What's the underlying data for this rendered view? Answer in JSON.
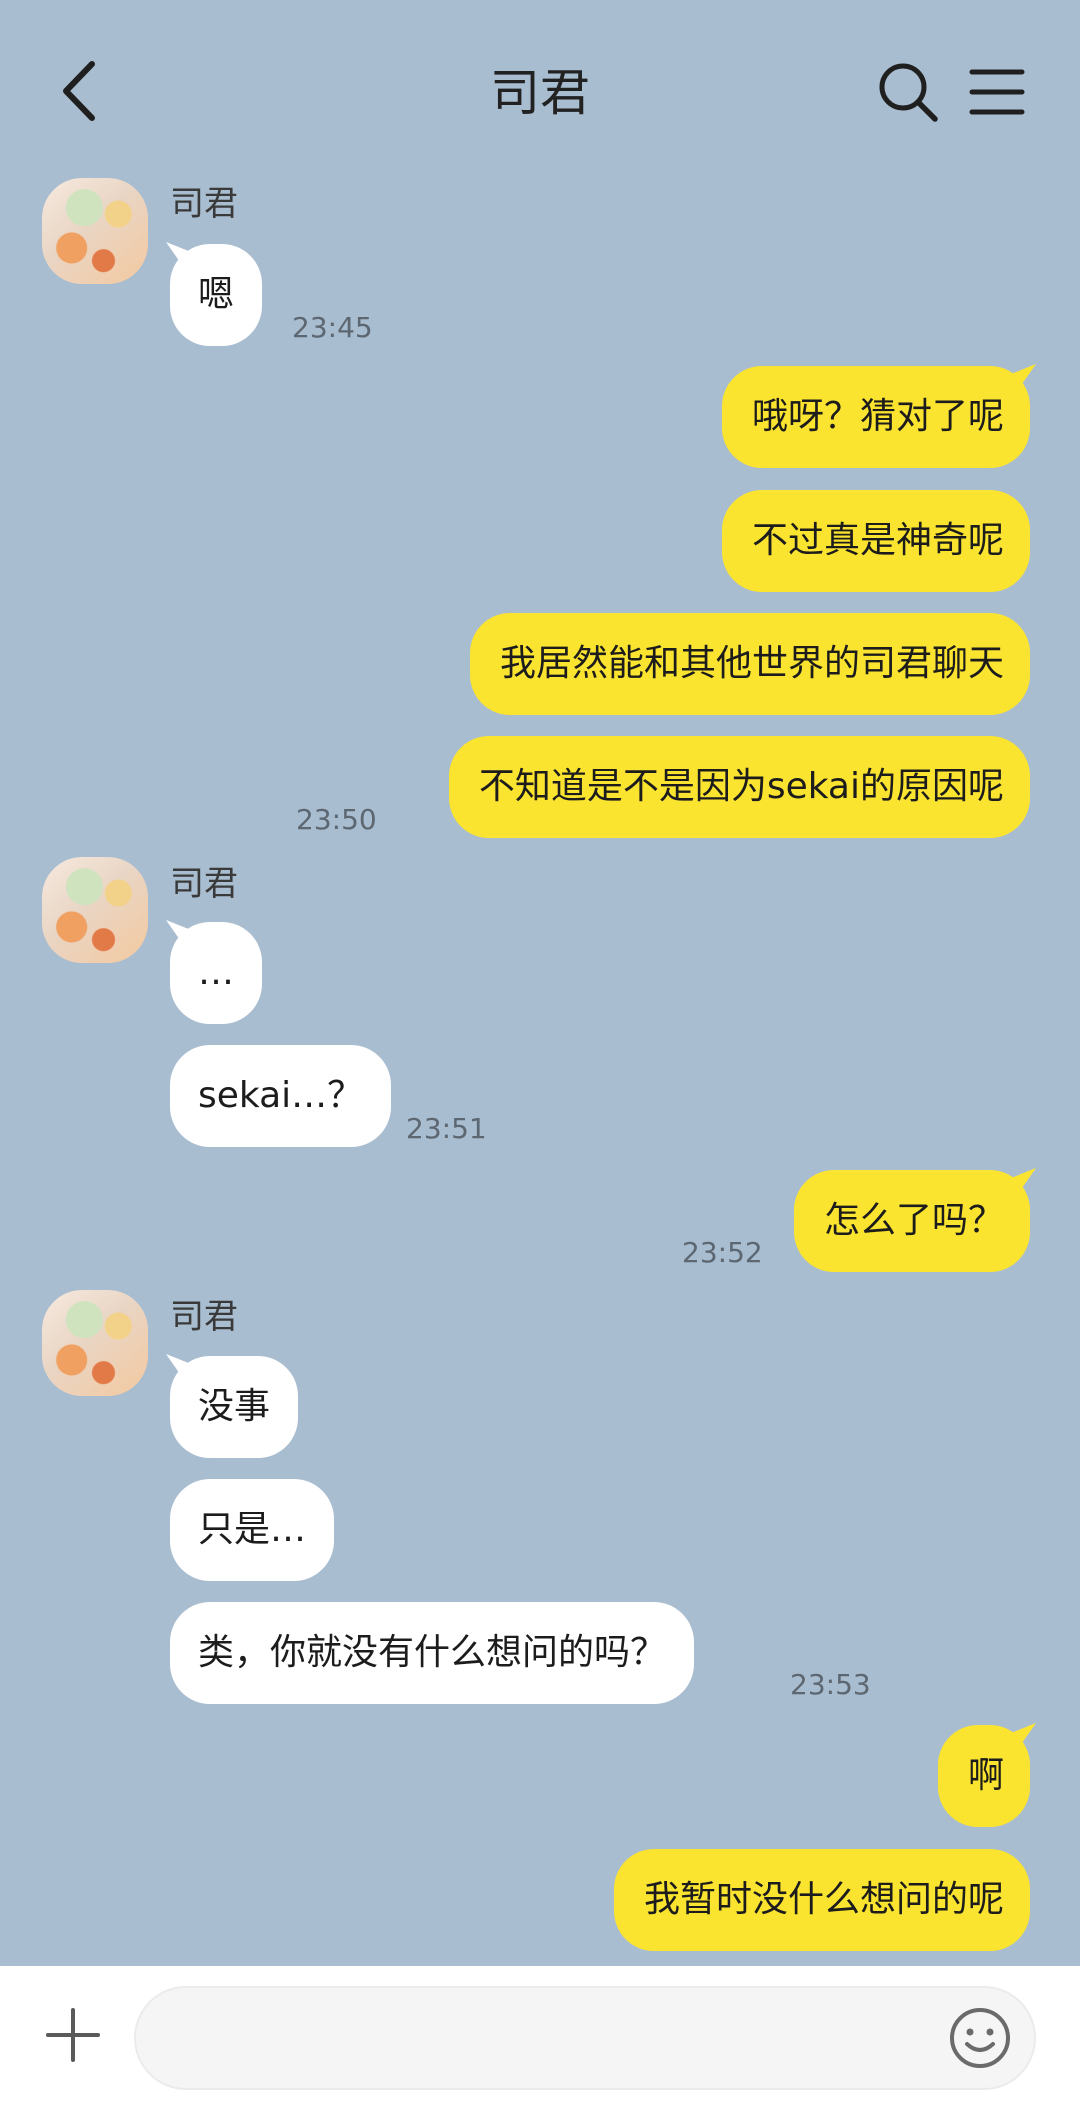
{
  "header": {
    "title": "司君"
  },
  "messages": [
    {
      "sender": "司君",
      "items": [
        "嗯"
      ],
      "time": "23:45"
    },
    {
      "sender": "me",
      "items": [
        "哦呀？猜对了呢",
        "不过真是神奇呢",
        "我居然能和其他世界的司君聊天",
        "不知道是不是因为sekai的原因呢"
      ],
      "time": "23:50"
    },
    {
      "sender": "司君",
      "items": [
        "…",
        "sekai…？"
      ],
      "time": "23:51"
    },
    {
      "sender": "me",
      "items": [
        "怎么了吗？"
      ],
      "time": "23:52"
    },
    {
      "sender": "司君",
      "items": [
        "没事",
        "只是…",
        "类，你就没有什么想问的吗？"
      ],
      "time": "23:53"
    },
    {
      "sender": "me",
      "items": [
        "啊",
        "我暂时没什么想问的呢"
      ],
      "time": ""
    }
  ],
  "input": {
    "value": "",
    "placeholder": ""
  },
  "icons": {
    "back": "chevron-left-icon",
    "search": "search-icon",
    "menu": "menu-icon",
    "plus": "plus-icon",
    "emoji": "smiley-icon"
  },
  "colors": {
    "background": "#a9bdd0",
    "outgoing_bubble": "#fbe42f",
    "incoming_bubble": "#ffffff"
  }
}
